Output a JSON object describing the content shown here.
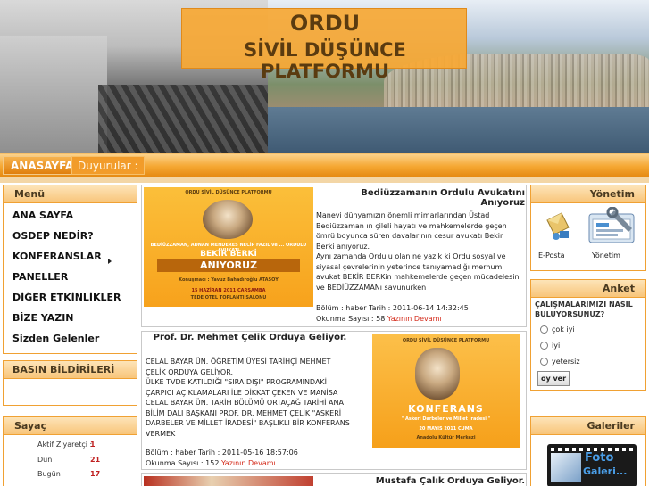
{
  "header": {
    "title_line1": "ORDU",
    "title_line2": "SİVİL DÜŞÜNCE PLATFORMU"
  },
  "nav": {
    "home": "ANASAYFA",
    "announcements": "Duyurular :"
  },
  "menu": {
    "title": "Menü",
    "items": [
      "ANA SAYFA",
      "OSDEP NEDİR?",
      "KONFERANSLAR",
      "PANELLER",
      "DİĞER ETKİNLİKLER",
      "BİZE YAZIN",
      "Sizden Gelenler"
    ]
  },
  "press": {
    "title": "BASIN BİLDİRİLERİ"
  },
  "counter": {
    "title": "Sayaç",
    "rows": [
      {
        "label": "Aktif Ziyaretçi :",
        "value": "1"
      },
      {
        "label": "Dün",
        "value": "21"
      },
      {
        "label": "Bugün",
        "value": "17"
      }
    ]
  },
  "news": [
    {
      "title": "Bediüzzamanın Ordulu Avukatını Anıyoruz",
      "body": "Manevi dünyamızın önemli mimarlarından Üstad Bediüzzaman ın çileli hayatı ve mahkemelerde geçen ömrü boyunca süren davalarının cesur avukatı Bekir Berki anıyoruz.\nAynı zamanda Ordulu olan ne yazık ki Ordu sosyal ve siyasal çevrelerinin yeterince tanıyamadığı merhum avukat BEKİR BERKin mahkemelerde geçen mücadelesini ve BEDİÜZZAMANı savunurken",
      "date": "Bölüm : haber Tarih : 2011-06-14 14:32:45",
      "reads": "Okunma Sayısı : 58",
      "more": "Yazının Devamı",
      "poster": {
        "org": "ORDU SİVİL DÜŞÜNCE PLATFORMU",
        "strip": "BEDİÜZZAMAN, ADNAN MENDERES NECİP FAZIL ve ... ORDULU AVUKATI",
        "name": "BEKİR BERKİ",
        "big": "ANIYORUZ",
        "speaker": "Konuşmacı : Yavuz Bahadıroğlu ATASOY",
        "when": "15 HAZİRAN 2011 ÇARŞAMBA",
        "where": "TEDE OTEL TOPLANTI SALONU"
      }
    },
    {
      "title": "Prof. Dr. Mehmet Çelik Orduya Geliyor.",
      "body": "CELAL BAYAR ÜN. ÖĞRETİM ÜYESİ TARİHÇİ MEHMET ÇELİK ORDUYA GELİYOR.\nÜLKE TVDE KATILDIĞI \"SIRA DIŞI\" PROGRAMINDAKİ ÇARPICI AÇIKLAMALARI İLE DİKKAT ÇEKEN VE MANİSA CELAL BAYAR ÜN. TARİH BÖLÜMÜ ORTAÇAĞ TARİHİ ANA BİLİM DALI BAŞKANI PROF. DR. MEHMET ÇELİK \"ASKERİ DARBELER VE MİLLET İRADESİ\" BAŞLIKLI BİR KONFERANS VERMEK",
      "date": "Bölüm : haber Tarih : 2011-05-16 18:57:06",
      "reads": "Okunma Sayısı : 152",
      "more": "Yazının Devamı",
      "poster": {
        "org": "ORDU SİVİL DÜŞÜNCE PLATFORMU",
        "big": "KONFERANS",
        "topic": "\" Askeri Darbeler ve Millet İradesi \"",
        "when": "20 MAYIS 2011 CUMA",
        "where": "Anadolu Kültür Merkezi"
      }
    },
    {
      "title": "Mustafa Çalık Orduya Geliyor."
    }
  ],
  "admin": {
    "title": "Yönetim",
    "email_label": "E-Posta",
    "admin_label": "Yönetim"
  },
  "poll": {
    "title": "Anket",
    "question": "ÇALIŞMALARIMIZI NASIL BULUYORSUNUZ?",
    "options": [
      "çok iyi",
      "iyi",
      "yetersiz"
    ],
    "button": "oy ver"
  },
  "gallery": {
    "title": "Galeriler",
    "banner_line1": "Foto",
    "banner_line2": "Galeri..."
  },
  "colors": {
    "orange": "#f5a732",
    "panel_border": "#f0a133",
    "link_red": "#d42a1a"
  }
}
